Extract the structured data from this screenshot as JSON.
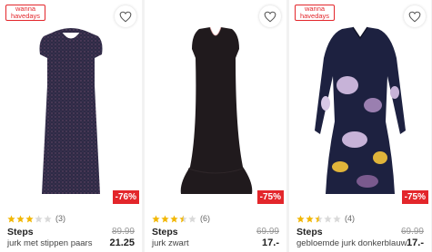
{
  "colors": {
    "accent": "#e3262b",
    "star_filled": "#f2b705",
    "star_empty": "#d9d9d9"
  },
  "products": [
    {
      "badge_line1": "wanna",
      "badge_line2": "havedays",
      "discount": "-76%",
      "rating_stars": 3,
      "rating_count": "(3)",
      "brand": "Steps",
      "old_price": "89.99",
      "name": "jurk met stippen paars",
      "price": "21.25"
    },
    {
      "badge_line1": "",
      "badge_line2": "",
      "discount": "-75%",
      "rating_stars": 3.5,
      "rating_count": "(6)",
      "brand": "Steps",
      "old_price": "69.99",
      "name": "jurk zwart",
      "price": "17.-"
    },
    {
      "badge_line1": "wanna",
      "badge_line2": "havedays",
      "discount": "-75%",
      "rating_stars": 2.5,
      "rating_count": "(4)",
      "brand": "Steps",
      "old_price": "69.99",
      "name": "gebloemde jurk donkerblauw",
      "price": "17.-"
    }
  ]
}
